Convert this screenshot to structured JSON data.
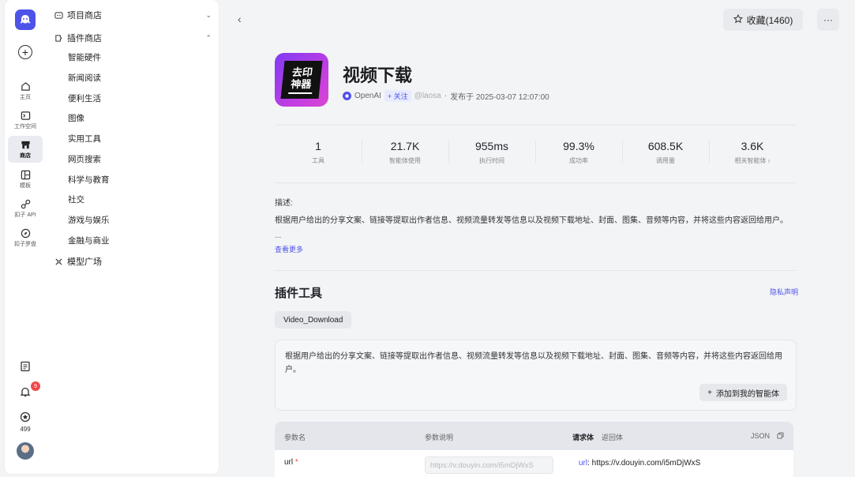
{
  "rail": {
    "items": [
      {
        "label": "主页"
      },
      {
        "label": "工作空间"
      },
      {
        "label": "商店"
      },
      {
        "label": "模板"
      },
      {
        "label": "扣子 API"
      },
      {
        "label": "扣子罗盘"
      }
    ],
    "notification_count": "9",
    "points": "499"
  },
  "nav": {
    "project_store": "项目商店",
    "plugin_store": "插件商店",
    "categories": [
      "智能硬件",
      "新闻阅读",
      "便利生活",
      "图像",
      "实用工具",
      "网页搜索",
      "科学与教育",
      "社交",
      "游戏与娱乐",
      "金融与商业"
    ],
    "model_square": "模型广场"
  },
  "header": {
    "favorite_label": "收藏(1460)",
    "more_label": "···"
  },
  "plugin": {
    "icon_text_line1": "去印",
    "icon_text_line2": "神器",
    "title": "视频下载",
    "publisher": "OpenAI",
    "follow_label": "+ 关注",
    "handle": "@laosa",
    "separator": "·",
    "published": "发布于 2025-03-07 12:07:00"
  },
  "stats": [
    {
      "value": "1",
      "label": "工具"
    },
    {
      "value": "21.7K",
      "label": "智能体使用"
    },
    {
      "value": "955ms",
      "label": "执行时间"
    },
    {
      "value": "99.3%",
      "label": "成功率"
    },
    {
      "value": "608.5K",
      "label": "调用量"
    },
    {
      "value": "3.6K",
      "label": "相关智能体 ›"
    }
  ],
  "description": {
    "label": "描述:",
    "text": "根据用户给出的分享文案、链接等提取出作者信息、视频流量转发等信息以及视频下载地址、封面、图集、音频等内容，并将这些内容返回给用户。",
    "ellipsis": "...",
    "read_more": "查看更多"
  },
  "tools": {
    "title": "插件工具",
    "privacy": "隐私声明",
    "tab": "Video_Download",
    "card_text": "根据用户给出的分享文案、链接等提取出作者信息、视频流量转发等信息以及视频下载地址、封面、图集、音频等内容，并将这些内容返回给用户。",
    "add_button": "添加到我的智能体"
  },
  "params": {
    "col_name": "参数名",
    "col_desc": "参数说明",
    "tab_request": "请求体",
    "tab_response": "返回体",
    "json_label": "JSON",
    "row_name": "url",
    "row_required": "*",
    "row_placeholder": "https://v.douyin.com/i5mDjWxS",
    "req_key": "url",
    "req_value": ": https://v.douyin.com/i5mDjWxS"
  }
}
